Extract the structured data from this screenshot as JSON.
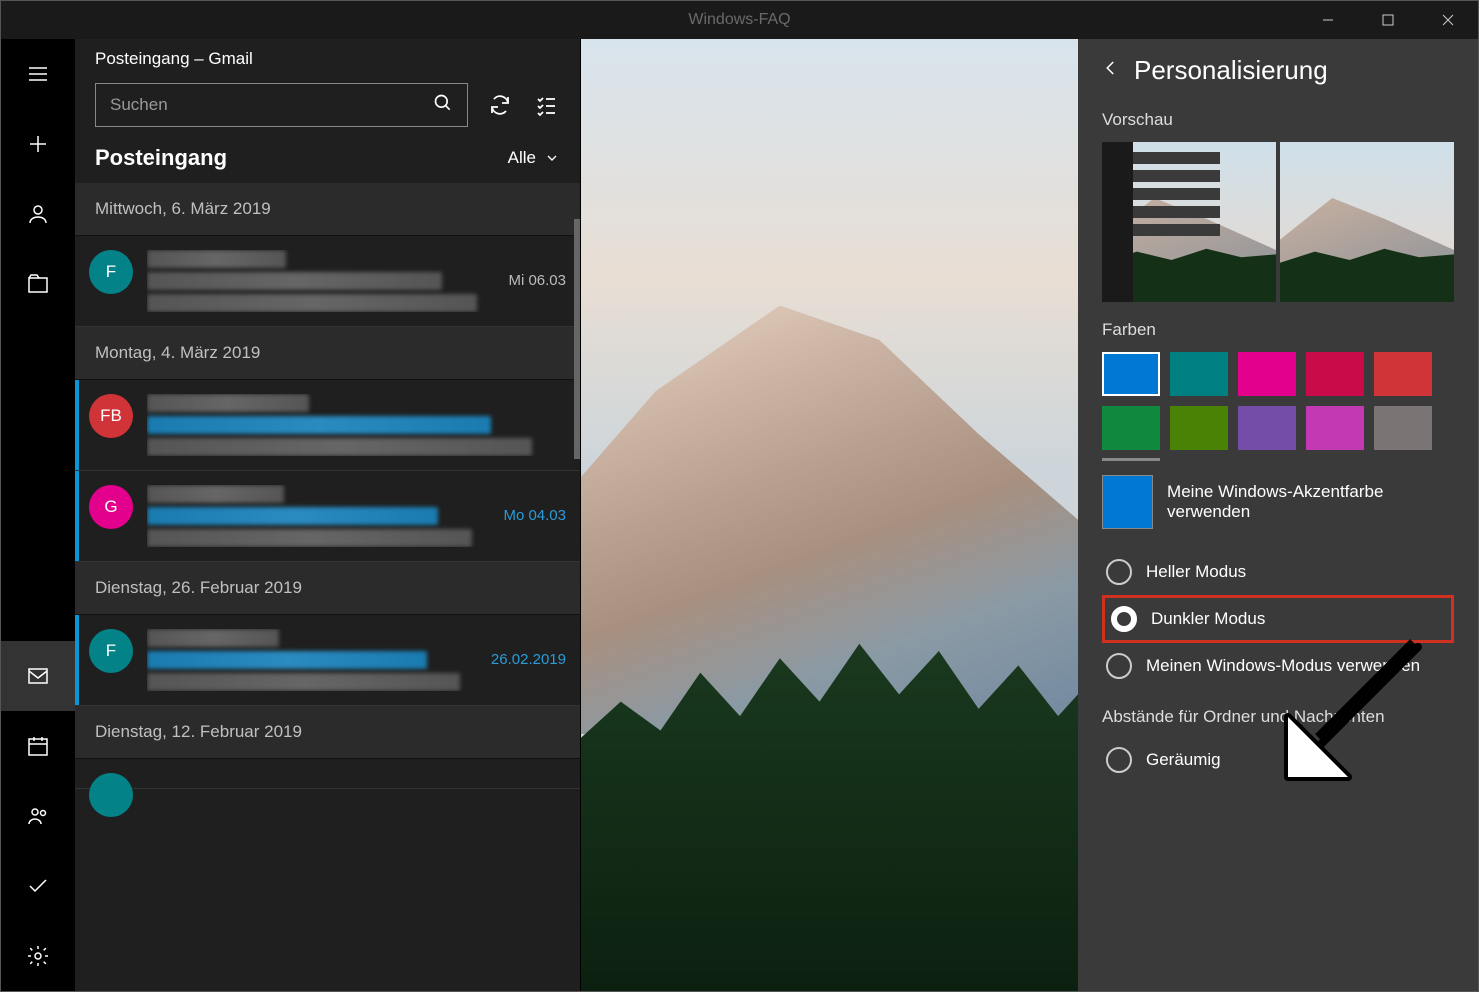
{
  "titlebar": {
    "watermark": "Windows-FAQ"
  },
  "sidebar": {
    "top": [
      "menu",
      "compose",
      "accounts",
      "folders"
    ],
    "bottom": [
      "mail",
      "calendar",
      "people",
      "todo",
      "settings"
    ],
    "active": "mail"
  },
  "listHeader": {
    "accountTitle": "Posteingang – Gmail",
    "searchPlaceholder": "Suchen",
    "inboxTitle": "Posteingang",
    "filterLabel": "Alle"
  },
  "groups": [
    {
      "date": "Mittwoch, 6. März 2019",
      "messages": [
        {
          "avatar": "F",
          "avatarColor": "#038387",
          "date": "Mi 06.03",
          "unread": false
        }
      ]
    },
    {
      "date": "Montag, 4. März 2019",
      "messages": [
        {
          "avatar": "FB",
          "avatarColor": "#d13438",
          "date": "",
          "unread": true
        },
        {
          "avatar": "G",
          "avatarColor": "#e3008c",
          "date": "Mo 04.03",
          "unread": true
        }
      ]
    },
    {
      "date": "Dienstag, 26. Februar 2019",
      "messages": [
        {
          "avatar": "F",
          "avatarColor": "#038387",
          "date": "26.02.2019",
          "unread": true
        }
      ]
    },
    {
      "date": "Dienstag, 12. Februar 2019",
      "messages": [
        {
          "avatar": "",
          "avatarColor": "#038387",
          "date": "",
          "unread": false,
          "partial": true
        }
      ]
    }
  ],
  "settings": {
    "title": "Personalisierung",
    "previewLabel": "Vorschau",
    "colorsLabel": "Farben",
    "colors": [
      {
        "hex": "#0078d4",
        "selected": true
      },
      {
        "hex": "#008080"
      },
      {
        "hex": "#e3008c"
      },
      {
        "hex": "#ca0b4a"
      },
      {
        "hex": "#d13438"
      },
      {
        "hex": "#10893e"
      },
      {
        "hex": "#498205"
      },
      {
        "hex": "#744da9"
      },
      {
        "hex": "#c239b3"
      },
      {
        "hex": "#7a7574"
      }
    ],
    "accentColor": "#0078d4",
    "accentLabel": "Meine Windows-Akzentfarbe verwenden",
    "modes": [
      {
        "key": "light",
        "label": "Heller Modus"
      },
      {
        "key": "dark",
        "label": "Dunkler Modus",
        "highlighted": true,
        "selected": true
      },
      {
        "key": "system",
        "label": "Meinen Windows-Modus verwenden"
      }
    ],
    "spacingLabel": "Abstände für Ordner und Nachrichten",
    "spacingOption": "Geräumig"
  }
}
